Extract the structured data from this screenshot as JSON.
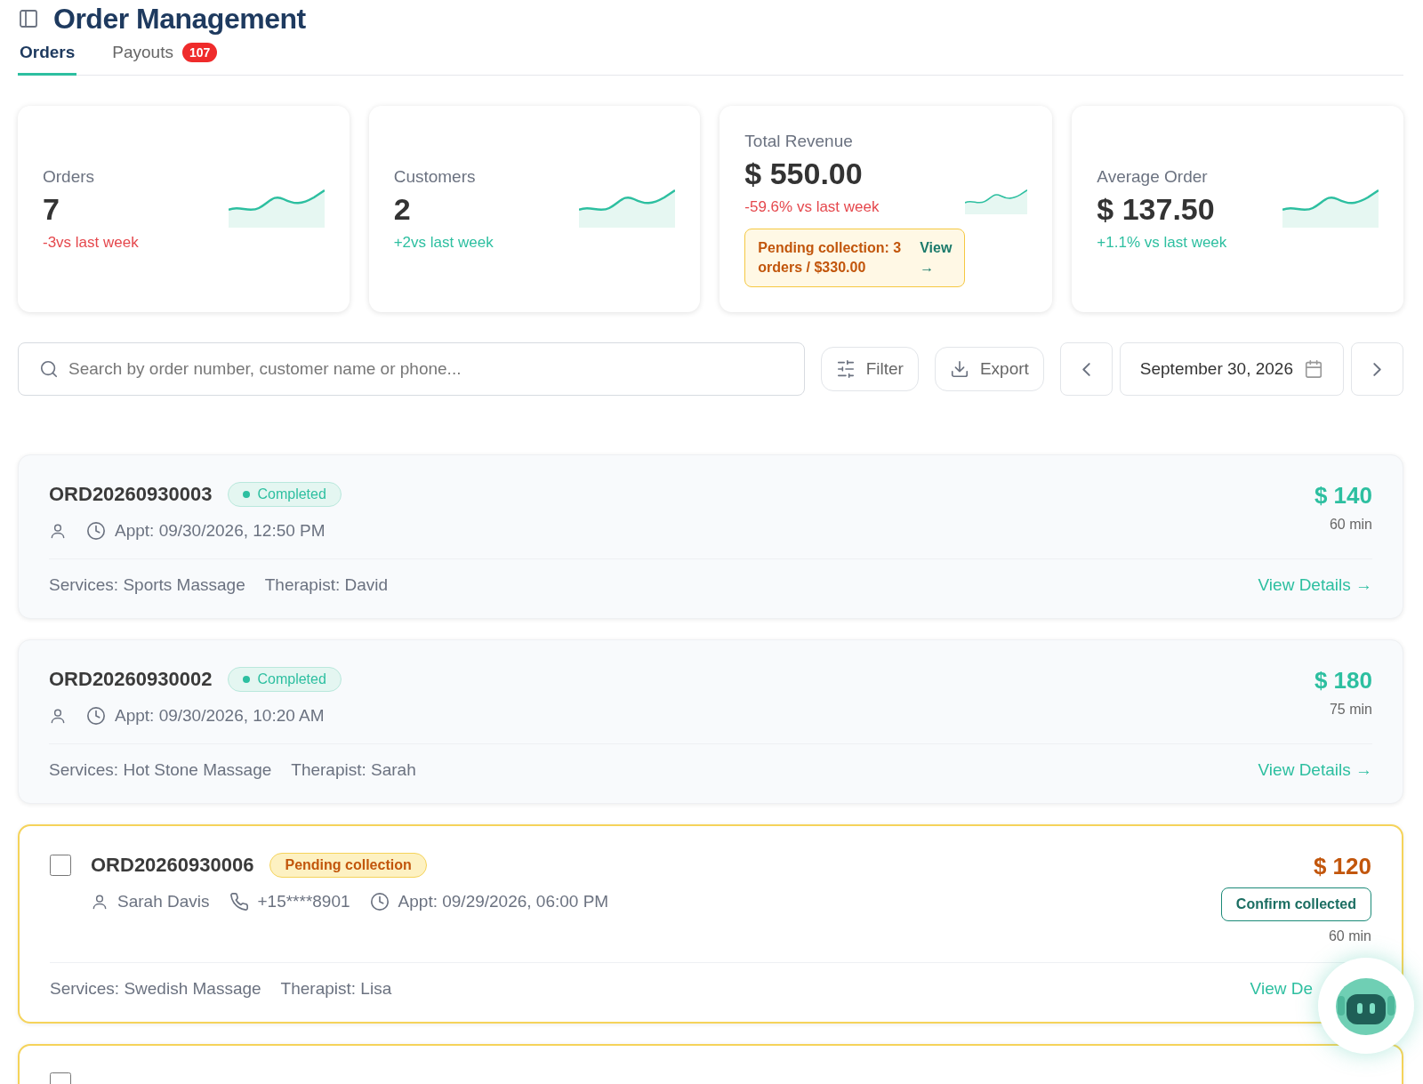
{
  "header": {
    "title": "Order Management"
  },
  "tabs": [
    {
      "label": "Orders",
      "selected": true
    },
    {
      "label": "Payouts",
      "selected": false,
      "badge": "107"
    }
  ],
  "stats": [
    {
      "label": "Orders",
      "value": "7",
      "delta": "-3vs last week",
      "color": "#e5484d"
    },
    {
      "label": "Customers",
      "value": "2",
      "delta": "+2vs last week",
      "color": "#2dbfa0"
    },
    {
      "label": "Total Revenue",
      "value": "$ 550.00",
      "delta": "-59.6% vs last week",
      "color": "#e5484d",
      "notice": {
        "text": "Pending collection: 3 orders / $330.00",
        "link": "View",
        "arrow": "→"
      }
    },
    {
      "label": "Average Order",
      "value": "$ 137.50",
      "delta": "+1.1% vs last week",
      "color": "#2dbfa0"
    }
  ],
  "toolbar": {
    "search": {
      "placeholder": "Search by order number, customer name or phone..."
    },
    "filter": "Filter",
    "export": "Export",
    "date": "September 30, 2026"
  },
  "orders": [
    {
      "kind": "completed",
      "number": "ORD20260930003",
      "status": "Completed",
      "appt": "Appt: 09/30/2026, 12:50 PM",
      "currency": "$",
      "amount": "140",
      "duration": "60 min",
      "services": "Services: Sports Massage",
      "therapist": "Therapist: David",
      "details": "View Details →"
    },
    {
      "kind": "completed",
      "number": "ORD20260930002",
      "status": "Completed",
      "appt": "Appt: 09/30/2026, 10:20 AM",
      "currency": "$",
      "amount": "180",
      "duration": "75 min",
      "services": "Services: Hot Stone Massage",
      "therapist": "Therapist: Sarah",
      "details": "View Details →"
    },
    {
      "kind": "pending",
      "checked": false,
      "number": "ORD20260930006",
      "status": "Pending collection",
      "customer": "Sarah Davis",
      "phone": "+15****8901",
      "appt": "Appt: 09/29/2026, 06:00 PM",
      "currency": "$",
      "amount": "120",
      "action": "Confirm collected",
      "duration": "60 min",
      "services": "Services: Swedish Massage",
      "therapist": "Therapist: Lisa",
      "details": "View De"
    },
    {
      "kind": "pending",
      "checked": false
    }
  ]
}
